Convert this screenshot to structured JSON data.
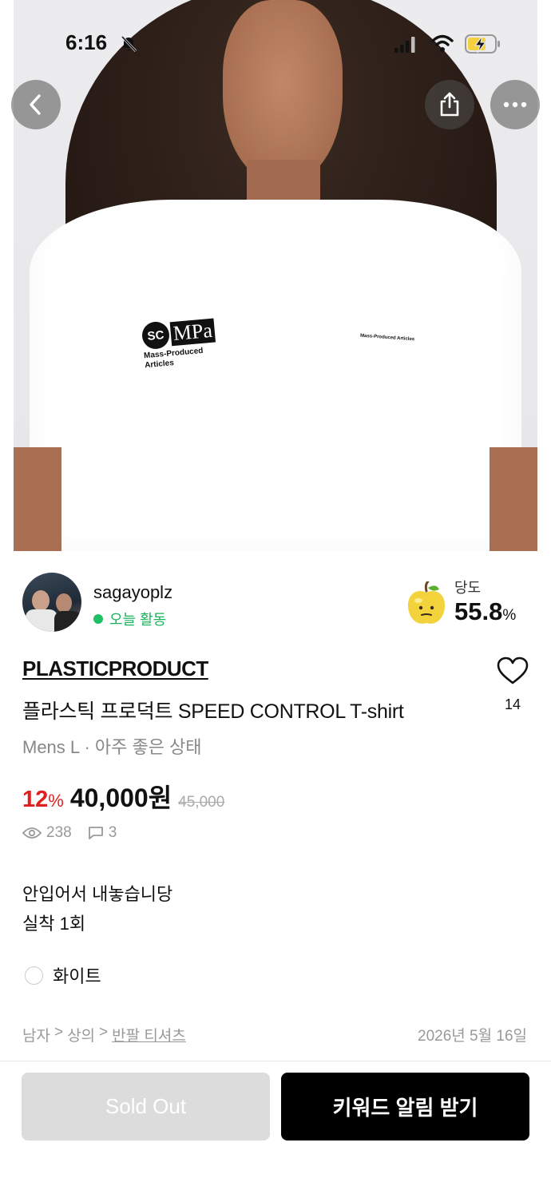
{
  "status_bar": {
    "time": "6:16"
  },
  "hero": {
    "logo_badge": "SC",
    "logo_mark": "MPa",
    "logo_text": "Mass-Produced Articles",
    "small_print": "Mass-Produced Articles"
  },
  "icons": {
    "back": "chevron-left-icon",
    "share": "share-icon",
    "more": "more-icon",
    "heart": "heart-icon",
    "eye": "eye-icon",
    "chat": "chat-icon",
    "apple": "apple-icon"
  },
  "seller": {
    "name": "sagayoplz",
    "status": "오늘 활동",
    "sweetness_label": "당도",
    "sweetness_value": "55.8",
    "sweetness_unit": "%"
  },
  "product": {
    "brand": "PLASTICPRODUCT",
    "title": "플라스틱 프로덕트 SPEED CONTROL T-shirt",
    "likes": "14",
    "meta": "Mens L · 아주 좋은 상태",
    "discount": "12",
    "discount_unit": "%",
    "price": "40,000원",
    "original_price": "45,000",
    "views": "238",
    "comments": "3",
    "description_line1": "안입어서 내놓습니당",
    "description_line2": "실착 1회",
    "color": "화이트"
  },
  "breadcrumb": {
    "level1": "남자",
    "sep": ">",
    "level2": "상의",
    "level3": "반팔 티셔츠"
  },
  "date": "2026년 5월 16일",
  "buttons": {
    "sold_out": "Sold Out",
    "keyword_alert": "키워드 알림 받기"
  },
  "colors": {
    "accent_red": "#e02020",
    "active_green": "#1fbf63",
    "primary_button": "#000000",
    "disabled_button": "#dcdcdc"
  }
}
